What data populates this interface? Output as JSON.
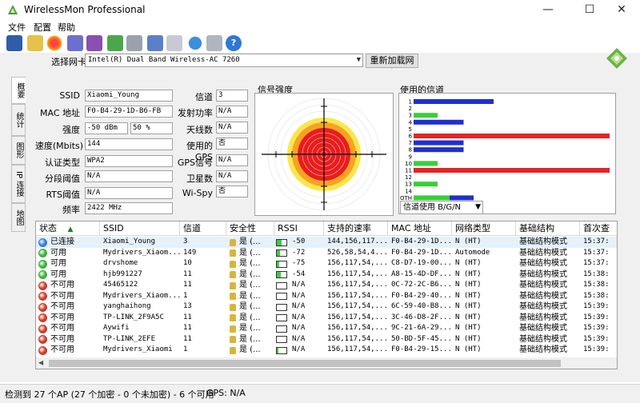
{
  "window": {
    "title": "WirelessMon Professional"
  },
  "menu": {
    "items": [
      "文件",
      "配置",
      "帮助"
    ]
  },
  "adapter": {
    "label": "选择网卡",
    "value": "Intel(R) Dual Band Wireless-AC 7260",
    "reload_label": "重新加载网卡"
  },
  "side_tabs": [
    "概要",
    "统计",
    "图形",
    "IP 连接",
    "地图"
  ],
  "info": {
    "ssid_label": "SSID",
    "ssid": "Xiaomi_Young",
    "mac_label": "MAC 地址",
    "mac": "F0-B4-29-1D-B6-FB",
    "strength_label": "强度",
    "strength_dbm": "-50 dBm",
    "strength_pct": "50 %",
    "speed_label": "速度(Mbits)",
    "speed": "144",
    "auth_label": "认证类型",
    "auth": "WPA2",
    "frag_label": "分段阈值",
    "frag": "N/A",
    "rts_label": "RTS阈值",
    "rts": "N/A",
    "freq_label": "频率",
    "freq": "2422 MHz",
    "channel_label": "信道",
    "channel": "3",
    "power_label": "发射功率",
    "power": "N/A",
    "antenna_label": "天线数",
    "antenna": "N/A",
    "gps_used_label": "使用的GPS",
    "gps_used": "否",
    "gps_signal_label": "GPS信号",
    "gps_signal": "N/A",
    "satellite_label": "卫星数",
    "satellite": "N/A",
    "wispy_label": "Wi-Spy",
    "wispy": "否"
  },
  "signal": {
    "title": "信号强度"
  },
  "channels": {
    "title": "使用的信道",
    "select_value": "信道使用 B/G/N",
    "labels": [
      "1",
      "2",
      "3",
      "4",
      "5",
      "6",
      "7",
      "8",
      "9",
      "10",
      "11",
      "12",
      "13",
      "14",
      "OTH"
    ],
    "bars": [
      [
        {
          "color": "#1f2fd1",
          "value": 0.4
        }
      ],
      [],
      [
        {
          "color": "#36d036",
          "value": 0.12
        }
      ],
      [
        {
          "color": "#1f2fd1",
          "value": 0.25
        }
      ],
      [],
      [
        {
          "color": "#e52424",
          "value": 0.98
        }
      ],
      [
        {
          "color": "#1f2fd1",
          "value": 0.25
        }
      ],
      [
        {
          "color": "#1f2fd1",
          "value": 0.25
        }
      ],
      [],
      [
        {
          "color": "#36d036",
          "value": 0.12
        }
      ],
      [
        {
          "color": "#e52424",
          "value": 0.98
        }
      ],
      [],
      [
        {
          "color": "#36d036",
          "value": 0.12
        }
      ],
      [],
      [
        {
          "color": "#36d036",
          "value": 0.18
        },
        {
          "color": "#1f2fd1",
          "value": 0.12
        }
      ]
    ],
    "colors": {
      "blue": "#1f2fd1",
      "green": "#36d036",
      "red": "#e52424"
    }
  },
  "table": {
    "headers": [
      "状态",
      "SSID",
      "信道",
      "安全性",
      "RSSI",
      "支持的速率",
      "MAC 地址",
      "网络类型",
      "基础结构",
      "首次查"
    ],
    "rows": [
      {
        "status": "已连接",
        "dot": "#3a7fd5",
        "ssid": "Xiaomi_Young",
        "channel": "3",
        "sec": "是 (...",
        "rssi": "-50",
        "rssi_fill": 0.5,
        "rates": "144,156,117...",
        "mac": "F0-B4-29-1D...",
        "net": "N (HT)",
        "infra": "基础结构模式",
        "first": "15:37:"
      },
      {
        "status": "可用",
        "dot": "#3bb33b",
        "ssid": "Mydrivers_Xiaom...",
        "channel": "149",
        "sec": "是 (...",
        "rssi": "-72",
        "rssi_fill": 0.3,
        "rates": "526,58,54,4...",
        "mac": "F0-B4-29-1D...",
        "net": "Automode",
        "infra": "基础结构模式",
        "first": "15:37:"
      },
      {
        "status": "可用",
        "dot": "#3bb33b",
        "ssid": "drvshome",
        "channel": "10",
        "sec": "是 (...",
        "rssi": "-75",
        "rssi_fill": 0.25,
        "rates": "156,117,54,...",
        "mac": "C8-D7-19-00...",
        "net": "N (HT)",
        "infra": "基础结构模式",
        "first": "15:37:"
      },
      {
        "status": "可用",
        "dot": "#3bb33b",
        "ssid": "hjb991227",
        "channel": "11",
        "sec": "是 (...",
        "rssi": "-54",
        "rssi_fill": 0.45,
        "rates": "156,117,54,...",
        "mac": "A8-15-4D-DF...",
        "net": "N (HT)",
        "infra": "基础结构模式",
        "first": "15:38:"
      },
      {
        "status": "不可用",
        "dot": "#cf3a2e",
        "ssid": "45465122",
        "channel": "11",
        "sec": "是 (...",
        "rssi": "N/A",
        "rssi_fill": 0,
        "rates": "156,117,54,...",
        "mac": "0C-72-2C-B6...",
        "net": "N (HT)",
        "infra": "基础结构模式",
        "first": "15:38:"
      },
      {
        "status": "不可用",
        "dot": "#cf3a2e",
        "ssid": "Mydrivers_Xiaom...",
        "channel": "1",
        "sec": "是 (...",
        "rssi": "N/A",
        "rssi_fill": 0,
        "rates": "156,117,54,...",
        "mac": "F0-B4-29-40...",
        "net": "N (HT)",
        "infra": "基础结构模式",
        "first": "15:38:"
      },
      {
        "status": "不可用",
        "dot": "#cf3a2e",
        "ssid": "yanghaihong",
        "channel": "13",
        "sec": "是 (...",
        "rssi": "N/A",
        "rssi_fill": 0,
        "rates": "156,117,54,...",
        "mac": "6C-59-40-B8...",
        "net": "N (HT)",
        "infra": "基础结构模式",
        "first": "15:39:"
      },
      {
        "status": "不可用",
        "dot": "#cf3a2e",
        "ssid": "TP-LINK_2F9A5C",
        "channel": "11",
        "sec": "是 (...",
        "rssi": "N/A",
        "rssi_fill": 0,
        "rates": "156,117,54,...",
        "mac": "3C-46-D8-2F...",
        "net": "N (HT)",
        "infra": "基础结构模式",
        "first": "15:39:"
      },
      {
        "status": "不可用",
        "dot": "#cf3a2e",
        "ssid": "Aywifi",
        "channel": "11",
        "sec": "是 (...",
        "rssi": "N/A",
        "rssi_fill": 0,
        "rates": "156,117,54,...",
        "mac": "9C-21-6A-29...",
        "net": "N (HT)",
        "infra": "基础结构模式",
        "first": "15:39:"
      },
      {
        "status": "不可用",
        "dot": "#cf3a2e",
        "ssid": "TP-LINK_2EFE",
        "channel": "11",
        "sec": "是 (...",
        "rssi": "N/A",
        "rssi_fill": 0,
        "rates": "156,117,54,...",
        "mac": "50-BD-5F-45...",
        "net": "N (HT)",
        "infra": "基础结构模式",
        "first": "15:39:"
      },
      {
        "status": "不可用",
        "dot": "#cf3a2e",
        "ssid": "Mydrivers_Xiaomi",
        "channel": "1",
        "sec": "是 (...",
        "rssi": "N/A",
        "rssi_fill": 0.2,
        "rates": "156,117,54,...",
        "mac": "F0-B4-29-15...",
        "net": "N (HT)",
        "infra": "基础结构模式",
        "first": "15:39:"
      }
    ]
  },
  "status": {
    "count": "检测到 27 个AP (27 个加密 - 0 个未加密) - 6 个可用",
    "gps": "GPS: N/A"
  }
}
